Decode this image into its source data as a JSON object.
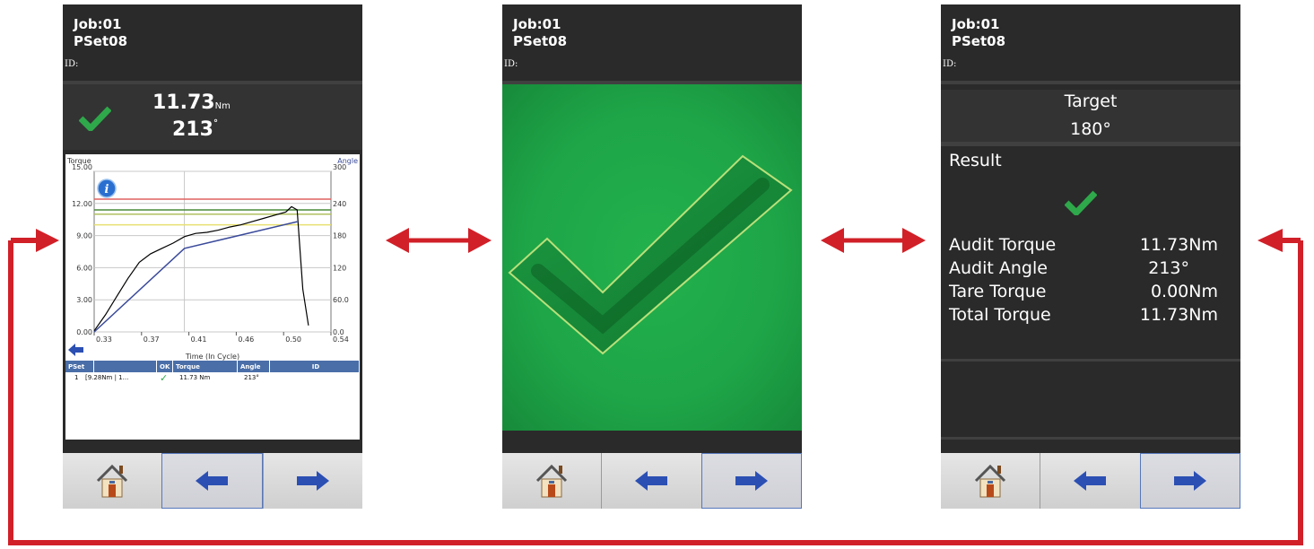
{
  "header": {
    "job": "Job:01",
    "pset": "PSet08",
    "id_label": "ID:"
  },
  "screen1": {
    "torque_value": "11.73",
    "torque_unit": "Nm",
    "angle_value": "213",
    "angle_unit": "°",
    "chart_data": {
      "type": "line",
      "title": "",
      "xlabel": "Time (In Cycle)",
      "ylabel_left": "Torque",
      "ylabel_right": "Angle",
      "xlim": [
        0.33,
        0.54
      ],
      "ylim_left": [
        0,
        15
      ],
      "ylim_right": [
        0,
        300
      ],
      "x_ticks": [
        "0.33",
        "0.37",
        "0.41",
        "0.46",
        "0.50",
        "0.54"
      ],
      "y_ticks_left": [
        "0.00",
        "3.00",
        "6.00",
        "9.00",
        "12.00",
        "15.00"
      ],
      "y_ticks_right": [
        "0.0",
        "60.0",
        "120",
        "180",
        "240",
        "300"
      ],
      "limit_lines_torque": [
        {
          "value": 12.4,
          "color": "#e06060"
        },
        {
          "value": 11.4,
          "color": "#4a8a3a"
        },
        {
          "value": 11.0,
          "color": "#b0c060"
        },
        {
          "value": 10.0,
          "color": "#e8e070"
        }
      ],
      "series": [
        {
          "name": "Torque",
          "color": "#000000",
          "x": [
            0.33,
            0.34,
            0.35,
            0.36,
            0.37,
            0.38,
            0.39,
            0.4,
            0.41,
            0.42,
            0.43,
            0.44,
            0.45,
            0.46,
            0.47,
            0.48,
            0.49,
            0.5,
            0.505,
            0.51,
            0.515,
            0.52
          ],
          "y": [
            0.1,
            1.6,
            3.3,
            5.0,
            6.5,
            7.3,
            7.8,
            8.3,
            8.9,
            9.2,
            9.3,
            9.5,
            9.8,
            10.0,
            10.3,
            10.6,
            10.9,
            11.2,
            11.7,
            11.4,
            4.0,
            0.6
          ]
        },
        {
          "name": "Angle",
          "color": "#3a4a9a",
          "x": [
            0.33,
            0.41,
            0.51
          ],
          "y": [
            0,
            156,
            206
          ]
        }
      ]
    },
    "table": {
      "headers": [
        "PSet",
        "OK",
        "Torque",
        "Angle",
        "ID"
      ],
      "rows": [
        {
          "pset": "1",
          "desc": "[9.28Nm | 1...",
          "ok": "✓",
          "torque": "11.73 Nm",
          "angle": "213°",
          "id": ""
        }
      ]
    }
  },
  "screen3": {
    "target_label": "Target",
    "target_value": "180°",
    "result_label": "Result",
    "results": [
      {
        "label": "Audit Torque",
        "value": "11.73Nm"
      },
      {
        "label": "Audit Angle",
        "value": "213°"
      },
      {
        "label": "Tare Torque",
        "value": "0.00Nm"
      },
      {
        "label": "Total Torque",
        "value": "11.73Nm"
      }
    ]
  },
  "colors": {
    "accent_red": "#d12028",
    "ok_green": "#2ea84a",
    "nav_blue": "#2b4fb3"
  }
}
